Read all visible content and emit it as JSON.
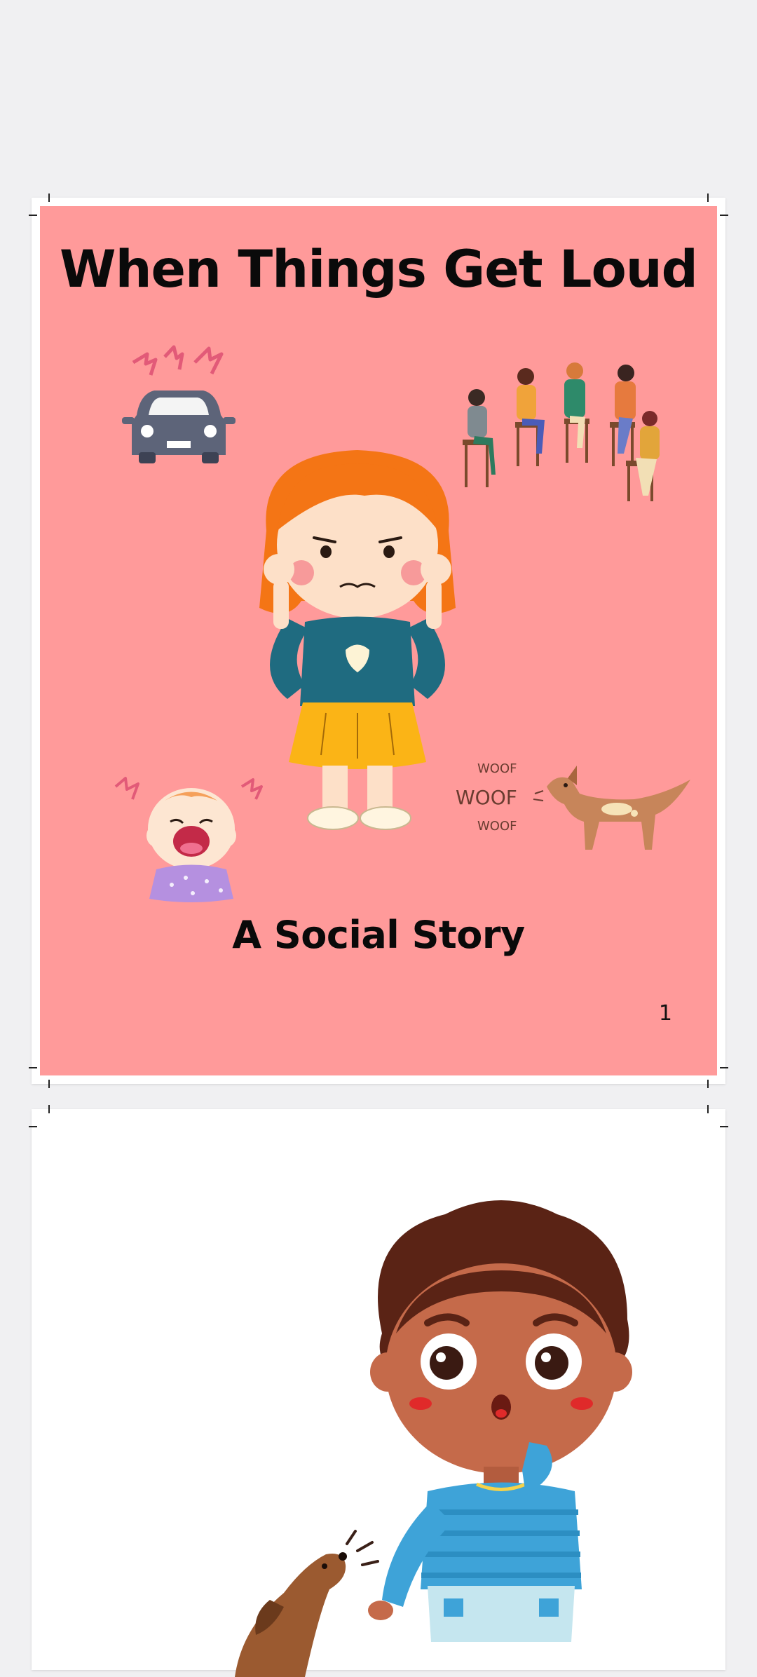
{
  "cover": {
    "title": "When Things Get Loud",
    "subtitle": "A Social Story",
    "page_number": "1",
    "background_color": "#ff9a9a",
    "illustrations": [
      "car-honking-icon",
      "group-talking-icon",
      "girl-covering-ears-icon",
      "crying-baby-icon",
      "barking-dog-icon"
    ],
    "dog_sound_words": [
      "WOOF",
      "WOOF",
      "WOOF"
    ]
  },
  "page2": {
    "illustrations": [
      "surprised-boy-icon",
      "barking-puppy-icon"
    ]
  }
}
